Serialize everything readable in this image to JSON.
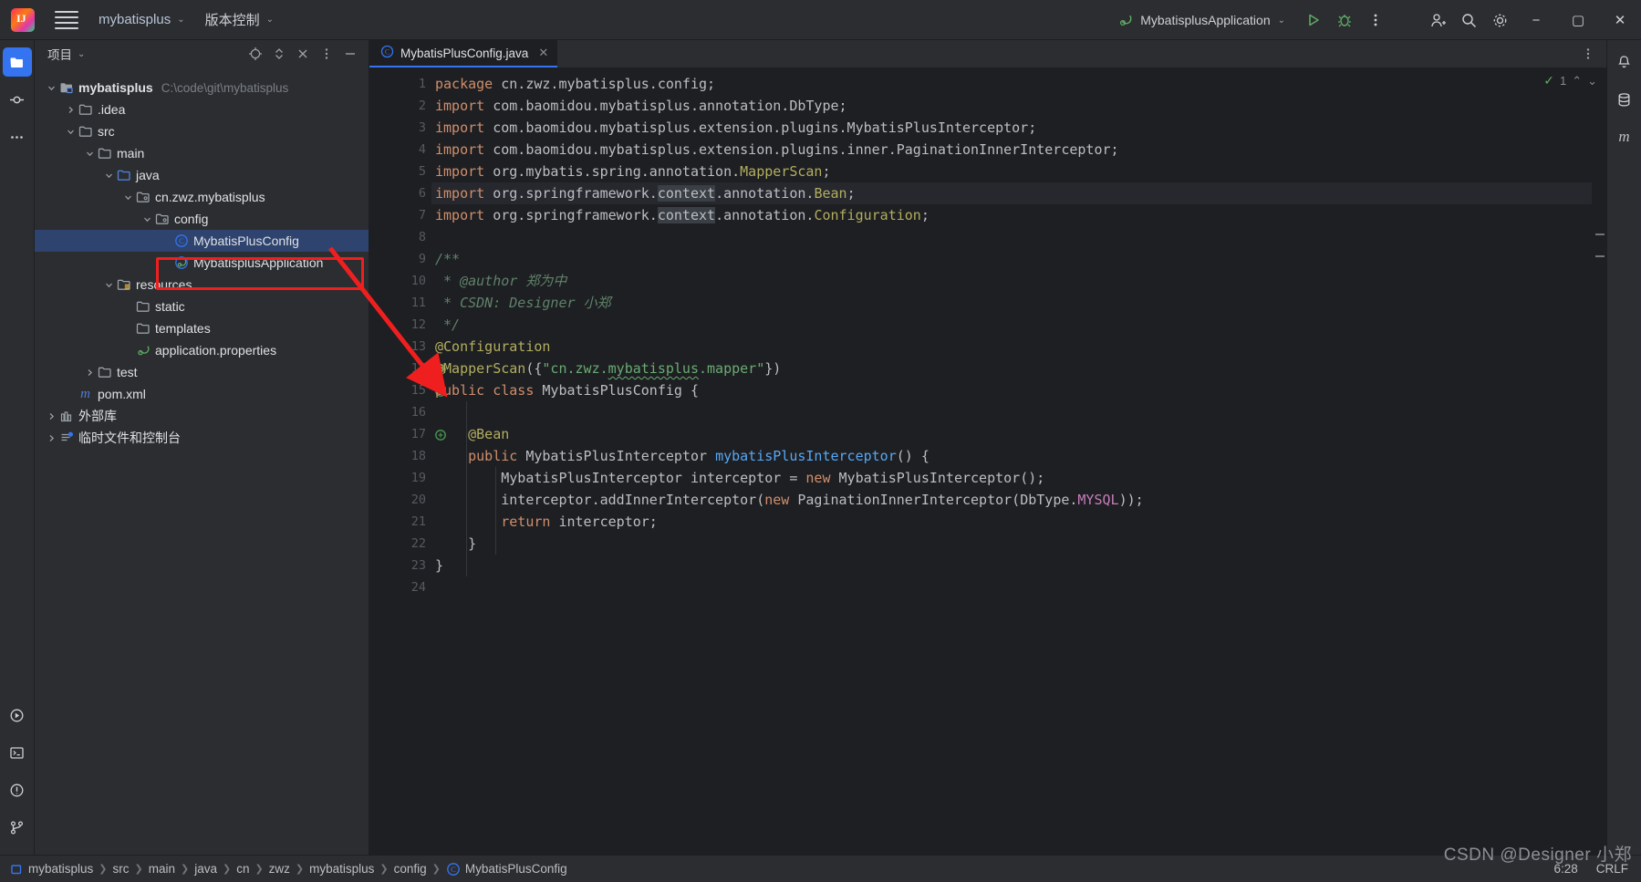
{
  "titlebar": {
    "logo": "intellij-idea-logo",
    "menu_icon": "hamburger-menu-icon",
    "project_name": "mybatisplus",
    "version_control": "版本控制",
    "run_config": "MybatisplusApplication",
    "icons": [
      "spring-boot-leaf-icon",
      "run-icon",
      "debug-icon",
      "more-vertical-icon",
      "add-user-icon",
      "search-icon",
      "settings-gear-icon"
    ],
    "window": {
      "minimize": "−",
      "maximize": "▢",
      "close": "✕"
    }
  },
  "left_rail": {
    "items": [
      {
        "name": "project-folder-icon",
        "active": true
      },
      {
        "name": "commit-icon",
        "active": false
      },
      {
        "name": "more-tools-icon",
        "active": false
      }
    ],
    "bottom_items": [
      {
        "name": "run-tool-icon"
      },
      {
        "name": "terminal-icon"
      },
      {
        "name": "problems-icon"
      },
      {
        "name": "git-branch-icon"
      }
    ]
  },
  "right_rail": {
    "items": [
      {
        "name": "notifications-bell-icon"
      },
      {
        "name": "database-icon"
      },
      {
        "name": "maven-icon",
        "label": "m"
      }
    ]
  },
  "project_panel": {
    "title": "项目",
    "actions": [
      "target-locate-icon",
      "expand-collapse-icon",
      "collapse-all-icon",
      "options-menu-icon",
      "hide-panel-icon"
    ],
    "tree": [
      {
        "depth": 0,
        "arrow": "down",
        "icon": "module-folder-icon",
        "label": "mybatisplus",
        "bold": true,
        "path": "C:\\code\\git\\mybatisplus"
      },
      {
        "depth": 1,
        "arrow": "right",
        "icon": "folder-icon",
        "label": ".idea"
      },
      {
        "depth": 1,
        "arrow": "down",
        "icon": "folder-icon",
        "label": "src"
      },
      {
        "depth": 2,
        "arrow": "down",
        "icon": "folder-icon",
        "label": "main"
      },
      {
        "depth": 3,
        "arrow": "down",
        "icon": "source-folder-icon",
        "label": "java"
      },
      {
        "depth": 4,
        "arrow": "down",
        "icon": "package-icon",
        "label": "cn.zwz.mybatisplus"
      },
      {
        "depth": 5,
        "arrow": "down",
        "icon": "package-icon",
        "label": "config"
      },
      {
        "depth": 6,
        "arrow": "none",
        "icon": "java-class-icon",
        "label": "MybatisPlusConfig",
        "selected": true
      },
      {
        "depth": 6,
        "arrow": "none",
        "icon": "spring-class-icon",
        "label": "MybatisplusApplication"
      },
      {
        "depth": 3,
        "arrow": "down",
        "icon": "resources-folder-icon",
        "label": "resources"
      },
      {
        "depth": 4,
        "arrow": "none",
        "icon": "folder-icon",
        "label": "static"
      },
      {
        "depth": 4,
        "arrow": "none",
        "icon": "folder-icon",
        "label": "templates"
      },
      {
        "depth": 4,
        "arrow": "none",
        "icon": "spring-properties-icon",
        "label": "application.properties"
      },
      {
        "depth": 2,
        "arrow": "right",
        "icon": "folder-icon",
        "label": "test"
      },
      {
        "depth": 1,
        "arrow": "none",
        "icon": "maven-pom-icon",
        "label": "pom.xml"
      },
      {
        "depth": 0,
        "arrow": "right",
        "icon": "external-libraries-icon",
        "label": "外部库"
      },
      {
        "depth": 0,
        "arrow": "right",
        "icon": "scratches-icon",
        "label": "临时文件和控制台"
      }
    ]
  },
  "editor": {
    "tab": {
      "label": "MybatisPlusConfig.java",
      "icon": "java-class-icon",
      "close": "✕"
    },
    "tab_actions": [
      "more-vertical-icon"
    ],
    "inspection": {
      "count": "1",
      "check": "✓",
      "up": "⌃",
      "down": "⌄"
    },
    "current_line": 6,
    "lines": [
      {
        "n": 1,
        "tokens": [
          {
            "t": "package",
            "c": "kw"
          },
          {
            "t": " cn.zwz.mybatisplus.config;",
            "c": "pkg"
          }
        ]
      },
      {
        "n": 2,
        "tokens": [
          {
            "t": "import",
            "c": "kw"
          },
          {
            "t": " com.baomidou.mybatisplus.annotation.DbType;",
            "c": "pkg"
          }
        ]
      },
      {
        "n": 3,
        "tokens": [
          {
            "t": "import",
            "c": "kw"
          },
          {
            "t": " com.baomidou.mybatisplus.extension.plugins.MybatisPlusInterceptor;",
            "c": "pkg"
          }
        ]
      },
      {
        "n": 4,
        "tokens": [
          {
            "t": "import",
            "c": "kw"
          },
          {
            "t": " com.baomidou.mybatisplus.extension.plugins.inner.PaginationInnerInterceptor;",
            "c": "pkg"
          }
        ]
      },
      {
        "n": 5,
        "tokens": [
          {
            "t": "import",
            "c": "kw"
          },
          {
            "t": " org.mybatis.spring.annotation.",
            "c": "pkg"
          },
          {
            "t": "MapperScan",
            "c": "ann"
          },
          {
            "t": ";",
            "c": "pkg"
          }
        ]
      },
      {
        "n": 6,
        "tokens": [
          {
            "t": "import",
            "c": "kw"
          },
          {
            "t": " org.springframework.",
            "c": "pkg"
          },
          {
            "t": "context",
            "c": "pkg hl"
          },
          {
            "t": ".annotation.",
            "c": "pkg"
          },
          {
            "t": "Bean",
            "c": "ann"
          },
          {
            "t": ";",
            "c": "pkg"
          }
        ]
      },
      {
        "n": 7,
        "tokens": [
          {
            "t": "import",
            "c": "kw"
          },
          {
            "t": " org.springframework.",
            "c": "pkg"
          },
          {
            "t": "context",
            "c": "pkg hl"
          },
          {
            "t": ".annotation.",
            "c": "pkg"
          },
          {
            "t": "Configuration",
            "c": "ann"
          },
          {
            "t": ";",
            "c": "pkg"
          }
        ]
      },
      {
        "n": 8,
        "tokens": []
      },
      {
        "n": 9,
        "tokens": [
          {
            "t": "/**",
            "c": "cmt"
          }
        ]
      },
      {
        "n": 10,
        "tokens": [
          {
            "t": " * @author 郑为中",
            "c": "cmt"
          }
        ]
      },
      {
        "n": 11,
        "tokens": [
          {
            "t": " * CSDN: Designer 小郑",
            "c": "cmt"
          }
        ]
      },
      {
        "n": 12,
        "tokens": [
          {
            "t": " */",
            "c": "cmt"
          }
        ]
      },
      {
        "n": 13,
        "tokens": [
          {
            "t": "@Configuration",
            "c": "ann"
          }
        ]
      },
      {
        "n": 14,
        "tokens": [
          {
            "t": "@MapperScan",
            "c": "ann"
          },
          {
            "t": "({",
            "c": "cls"
          },
          {
            "t": "\"cn.zwz.",
            "c": "str"
          },
          {
            "t": "mybatisplus",
            "c": "str squig"
          },
          {
            "t": ".mapper\"",
            "c": "str"
          },
          {
            "t": "})",
            "c": "cls"
          }
        ],
        "gutter_icon": "bean-gutter-icon"
      },
      {
        "n": 15,
        "tokens": [
          {
            "t": "public class",
            "c": "kw"
          },
          {
            "t": " MybatisPlusConfig {",
            "c": "cls"
          }
        ],
        "gutter_icon": "spring-bean-icon"
      },
      {
        "n": 16,
        "tokens": []
      },
      {
        "n": 17,
        "tokens": [
          {
            "t": "    @Bean",
            "c": "ann"
          }
        ],
        "gutter_icon": "bean-method-icon"
      },
      {
        "n": 18,
        "tokens": [
          {
            "t": "    ",
            "c": "cls"
          },
          {
            "t": "public",
            "c": "kw"
          },
          {
            "t": " MybatisPlusInterceptor ",
            "c": "cls"
          },
          {
            "t": "mybatisPlusInterceptor",
            "c": "fn"
          },
          {
            "t": "() {",
            "c": "cls"
          }
        ]
      },
      {
        "n": 19,
        "tokens": [
          {
            "t": "        MybatisPlusInterceptor interceptor = ",
            "c": "cls"
          },
          {
            "t": "new",
            "c": "kw"
          },
          {
            "t": " MybatisPlusInterceptor();",
            "c": "cls"
          }
        ]
      },
      {
        "n": 20,
        "tokens": [
          {
            "t": "        interceptor.addInnerInterceptor(",
            "c": "cls"
          },
          {
            "t": "new",
            "c": "kw"
          },
          {
            "t": " PaginationInnerInterceptor(DbType.",
            "c": "cls"
          },
          {
            "t": "MYSQL",
            "c": "num"
          },
          {
            "t": "));",
            "c": "cls"
          }
        ]
      },
      {
        "n": 21,
        "tokens": [
          {
            "t": "        ",
            "c": "cls"
          },
          {
            "t": "return",
            "c": "kw"
          },
          {
            "t": " interceptor;",
            "c": "cls"
          }
        ]
      },
      {
        "n": 22,
        "tokens": [
          {
            "t": "    }",
            "c": "cls"
          }
        ]
      },
      {
        "n": 23,
        "tokens": [
          {
            "t": "}",
            "c": "cls"
          }
        ]
      },
      {
        "n": 24,
        "tokens": []
      }
    ]
  },
  "breadcrumb": {
    "items": [
      {
        "label": "mybatisplus",
        "icon": "module-icon"
      },
      {
        "label": "src"
      },
      {
        "label": "main"
      },
      {
        "label": "java"
      },
      {
        "label": "cn"
      },
      {
        "label": "zwz"
      },
      {
        "label": "mybatisplus"
      },
      {
        "label": "config"
      },
      {
        "label": "MybatisPlusConfig",
        "icon": "java-class-icon"
      }
    ],
    "separator": "❯",
    "caret_position": "6:28",
    "line_separator": "CRLF"
  },
  "annotation": {
    "watermark": "CSDN @Designer 小郑",
    "highlight_color": "#f01f1f"
  }
}
